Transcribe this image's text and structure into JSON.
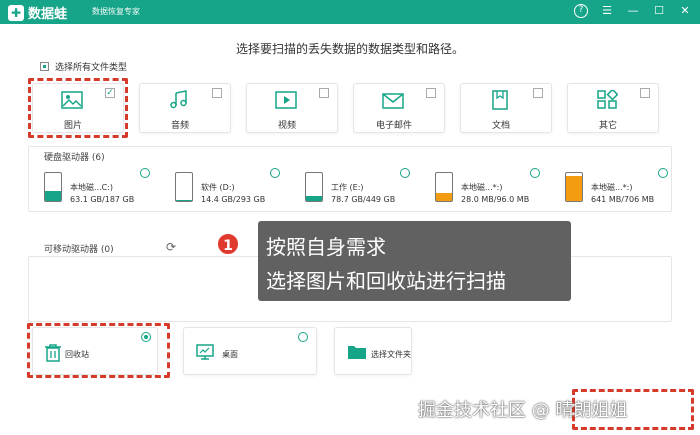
{
  "app": {
    "name": "数据蛙",
    "subtitle": "数据恢复专家"
  },
  "heading": "选择要扫描的丢失数据的数据类型和路径。",
  "select_all": {
    "label": "选择所有文件类型",
    "checked": true
  },
  "file_types": [
    {
      "label": "图片",
      "icon": "image-icon",
      "checked": true
    },
    {
      "label": "音频",
      "icon": "music-icon",
      "checked": false
    },
    {
      "label": "视频",
      "icon": "video-icon",
      "checked": false
    },
    {
      "label": "电子邮件",
      "icon": "email-icon",
      "checked": false
    },
    {
      "label": "文档",
      "icon": "document-icon",
      "checked": false
    },
    {
      "label": "其它",
      "icon": "other-icon",
      "checked": false
    }
  ],
  "hard_drives": {
    "label": "硬盘驱动器 (6)",
    "drives": [
      {
        "name": "本地磁...C:)",
        "size": "63.1 GB/187 GB",
        "fill": 0.34,
        "color": "#17a589"
      },
      {
        "name": "软件 (D:)",
        "size": "14.4 GB/293 GB",
        "fill": 0.05,
        "color": "#17a589"
      },
      {
        "name": "工作 (E:)",
        "size": "78.7 GB/449 GB",
        "fill": 0.18,
        "color": "#17a589"
      },
      {
        "name": "本地磁...*:)",
        "size": "28.0 MB/96.0 MB",
        "fill": 0.29,
        "color": "#f39c12"
      },
      {
        "name": "本地磁...*:)",
        "size": "641 MB/706 MB",
        "fill": 0.91,
        "color": "#f39c12"
      }
    ]
  },
  "removable": {
    "label": "可移动驱动器 (0)"
  },
  "locations": [
    {
      "label": "回收站",
      "icon": "trash-icon",
      "selected": true
    },
    {
      "label": "桌面",
      "icon": "desktop-icon",
      "selected": false
    },
    {
      "label": "选择文件夹",
      "icon": "folder-icon",
      "selected": false
    }
  ],
  "tooltip": {
    "step": "1",
    "line1": "按照自身需求",
    "line2": "选择图片和回收站进行扫描"
  },
  "watermark": "掘金技术社区 @ 晴朗姐姐"
}
